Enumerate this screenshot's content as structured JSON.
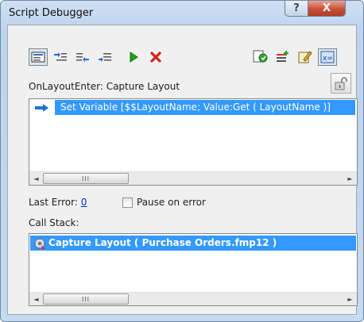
{
  "window": {
    "title": "Script Debugger",
    "help_glyph": "?",
    "close_glyph": "X"
  },
  "toolbar": {
    "step_label": "Step",
    "step_into_label": "Step Into",
    "step_out_label": "Step Out",
    "set_next_step_label": "Set Next Step",
    "run_label": "Run",
    "halt_label": "Halt Script",
    "edit_script_label": "Edit Script",
    "set_clear_breakpoint_label": "Set/Clear Breakpoint",
    "open_data_viewer_label": "Data Viewer"
  },
  "script": {
    "header": "OnLayoutEnter: Capture Layout",
    "steps": [
      {
        "text": "Set Variable [$$LayoutName; Value:Get ( LayoutName )]",
        "selected": true,
        "current": true
      }
    ]
  },
  "scrollbar": {
    "left_arrow": "◄",
    "right_arrow": "►",
    "grip": "III"
  },
  "status": {
    "last_error_label": "Last Error:",
    "last_error_value": "0",
    "pause_on_error_label": "Pause on error",
    "pause_on_error_checked": false
  },
  "call_stack": {
    "label": "Call Stack:",
    "items": [
      {
        "text": "Capture Layout ( Purchase Orders.fmp12 )",
        "selected": true
      }
    ]
  },
  "colors": {
    "selection": "#3399ff",
    "link": "#0033cc",
    "current_step_arrow": "#1f6fd8"
  }
}
